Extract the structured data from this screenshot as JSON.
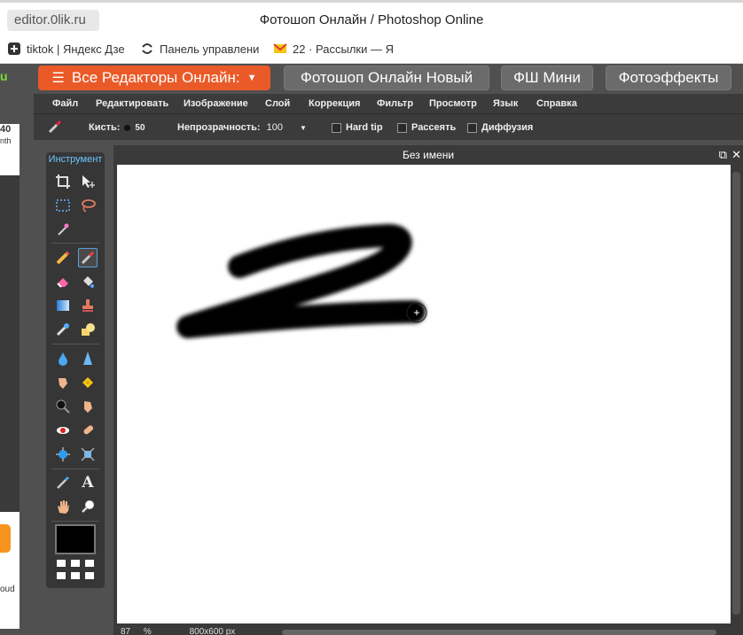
{
  "browser": {
    "url": "editor.0lik.ru",
    "window_title": "Фотошоп Онлайн / Photoshop Online",
    "bookmarks": [
      {
        "label": "tiktok | Яндекс Дзе",
        "icon": "plus-square-icon"
      },
      {
        "label": "Панель управлени",
        "icon": "loader-icon"
      },
      {
        "label": "22 · Рассылки — Я",
        "icon": "mail-icon"
      }
    ]
  },
  "left_ad": {
    "top_text": "u",
    "badge": "40",
    "sub": "nth",
    "bottom": "oud"
  },
  "top_nav": {
    "editors_dropdown": "Все Редакторы Онлайн:",
    "buttons": [
      "Фотошоп Онлайн Новый",
      "ФШ Мини",
      "Фотоэффекты"
    ]
  },
  "menu": [
    "Файл",
    "Редактировать",
    "Изображение",
    "Слой",
    "Коррекция",
    "Фильтр",
    "Просмотр",
    "Язык",
    "Справка"
  ],
  "options": {
    "brush_label": "Кисть:",
    "brush_size": "50",
    "opacity_label": "Непрозрачность:",
    "opacity_value": "100",
    "hard_tip": "Hard tip",
    "scatter": "Рассеять",
    "diffusion": "Диффузия"
  },
  "tools": {
    "title": "Инструмент"
  },
  "document": {
    "title": "Без имени",
    "zoom": "87",
    "zoom_unit": "%",
    "size": "800x600 px"
  },
  "colors": {
    "accent_orange": "#ea5a28",
    "tool_title": "#6ec6ff"
  }
}
